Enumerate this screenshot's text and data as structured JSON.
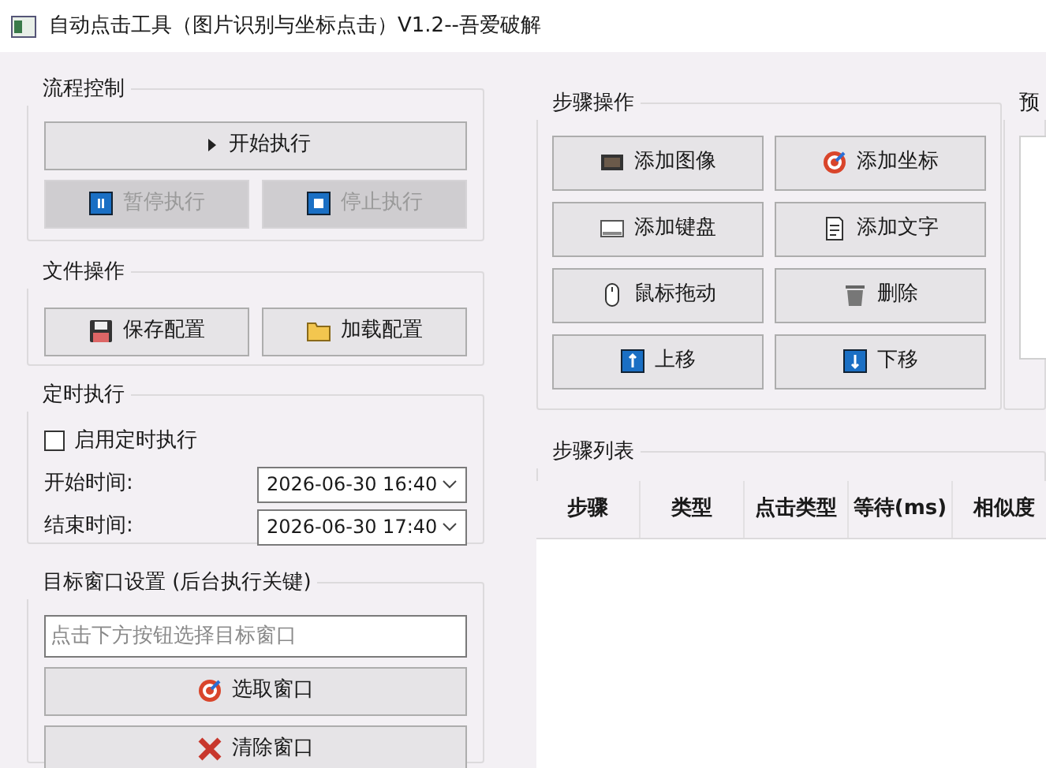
{
  "window": {
    "title": "自动点击工具（图片识别与坐标点击）V1.2--吾爱破解"
  },
  "flow_control": {
    "title": "流程控制",
    "start_button": {
      "label": "开始执行",
      "kind": "play",
      "disabled": false
    },
    "buttons": [
      {
        "label": "暂停执行",
        "kind": "pause",
        "disabled": true
      },
      {
        "label": "停止执行",
        "kind": "stop",
        "disabled": true
      }
    ]
  },
  "file_ops": {
    "title": "文件操作",
    "buttons": [
      {
        "label": "保存配置",
        "kind": "save",
        "disabled": false
      },
      {
        "label": "加载配置",
        "kind": "folder",
        "disabled": false
      }
    ]
  },
  "schedule": {
    "title": "定时执行",
    "enable": {
      "label": "启用定时执行",
      "checked": false
    },
    "start_time": {
      "label": "开始时间:",
      "value": "2026-06-30 16:40"
    },
    "end_time": {
      "label": "结束时间:",
      "value": "2026-06-30 17:40"
    }
  },
  "target_window": {
    "title": "目标窗口设置 (后台执行关键)",
    "field": {
      "placeholder": "点击下方按钮选择目标窗口"
    },
    "buttons": [
      {
        "label": "选取窗口",
        "kind": "target",
        "disabled": false
      },
      {
        "label": "清除窗口",
        "kind": "cross",
        "disabled": false
      }
    ]
  },
  "step_ops": {
    "title": "步骤操作",
    "buttons": [
      {
        "label": "添加图像",
        "kind": "image",
        "disabled": false
      },
      {
        "label": "添加坐标",
        "kind": "target",
        "disabled": false
      },
      {
        "label": "添加键盘",
        "kind": "keyboard",
        "disabled": false
      },
      {
        "label": "添加文字",
        "kind": "note",
        "disabled": false
      },
      {
        "label": "鼠标拖动",
        "kind": "mouse",
        "disabled": false
      },
      {
        "label": "删除",
        "kind": "trash",
        "disabled": false
      },
      {
        "label": "上移",
        "kind": "up",
        "disabled": false
      },
      {
        "label": "下移",
        "kind": "down",
        "disabled": false
      }
    ]
  },
  "preview": {
    "title": "预"
  },
  "step_list": {
    "title": "步骤列表",
    "columns": [
      "步骤",
      "类型",
      "点击类型",
      "等待(ms)",
      "相似度"
    ]
  }
}
